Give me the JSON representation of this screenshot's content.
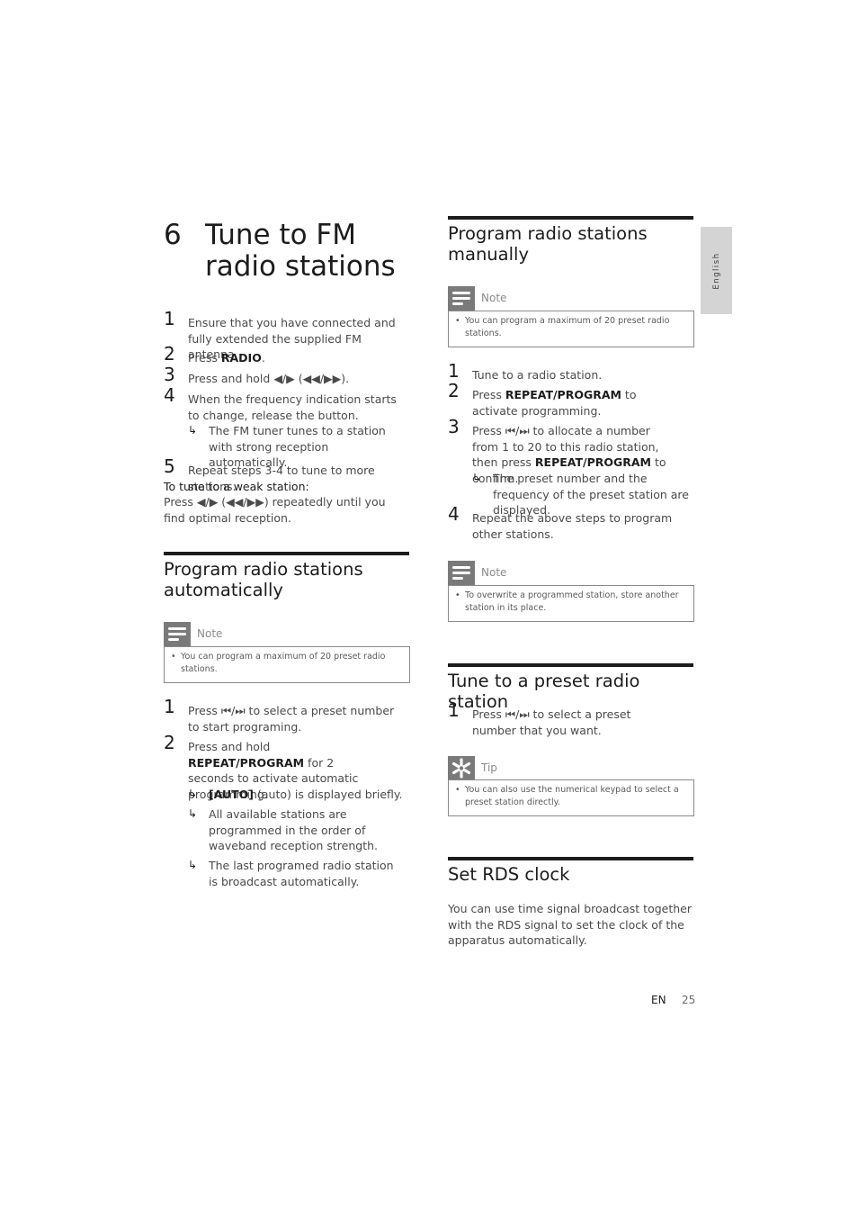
{
  "chapter": {
    "number": "6",
    "title": "Tune to FM radio stations"
  },
  "tune": {
    "steps": [
      {
        "n": "1",
        "text": "Ensure that you have connected and fully extended the supplied FM antenna."
      },
      {
        "n": "2",
        "pre": "Press ",
        "bold": "RADIO",
        "post": "."
      },
      {
        "n": "3",
        "text": "Press and hold ◀/▶ (◀◀/▶▶)."
      },
      {
        "n": "4",
        "text": "When the frequency indication starts to change, release the button.",
        "result": "The FM tuner tunes to a station with strong reception automatically."
      },
      {
        "n": "5",
        "text": "Repeat steps 3-4 to tune to more stations."
      }
    ],
    "weak_label": "To tune to a weak station:",
    "weak_text": "Press ◀/▶ (◀◀/▶▶) repeatedly until you find optimal reception."
  },
  "auto": {
    "heading": "Program radio stations automatically",
    "note_label": "Note",
    "note_text": "You can program a maximum of 20 preset radio stations.",
    "steps": [
      {
        "n": "1",
        "text": "Press ⏮/⏭ to select a preset number to start programing."
      },
      {
        "n": "2",
        "pre": "Press and hold ",
        "bold": "REPEAT/PROGRAM",
        "post": " for 2 seconds to activate automatic programming."
      }
    ],
    "results": [
      {
        "bold": "[AUTO]",
        "text": " (auto) is displayed briefly."
      },
      {
        "text": "All available stations are programmed in the order of waveband reception strength."
      },
      {
        "text": "The last programed radio station is broadcast automatically."
      }
    ]
  },
  "manual": {
    "heading": "Program radio stations manually",
    "note_label": "Note",
    "note_text": "You can program a maximum of 20 preset radio stations.",
    "steps": [
      {
        "n": "1",
        "text": "Tune to a radio station."
      },
      {
        "n": "2",
        "pre": "Press ",
        "bold": "REPEAT/PROGRAM",
        "post": " to activate programming."
      },
      {
        "n": "3",
        "pre": "Press ⏮/⏭ to allocate a number from 1 to 20 to this radio station, then press ",
        "bold": "REPEAT/PROGRAM",
        "post": " to confirm.",
        "result": "The preset number and the frequency of the preset station are displayed."
      },
      {
        "n": "4",
        "text": "Repeat the above steps to program other stations."
      }
    ],
    "note2_label": "Note",
    "note2_text": "To overwrite a programmed station, store another station in its place."
  },
  "preset": {
    "heading": "Tune to a preset radio station",
    "steps": [
      {
        "n": "1",
        "text": "Press ⏮/⏭ to select a preset number that you want."
      }
    ],
    "tip_label": "Tip",
    "tip_text": "You can also use the numerical keypad to select a preset station directly."
  },
  "rds": {
    "heading": "Set RDS clock",
    "text": "You can use time signal broadcast together with the RDS signal to set the clock of the apparatus automatically."
  },
  "side_tab": "English",
  "footer": {
    "lang": "EN",
    "page": "25"
  },
  "icons": {
    "result_arrow": "↳",
    "bullet": "•"
  }
}
